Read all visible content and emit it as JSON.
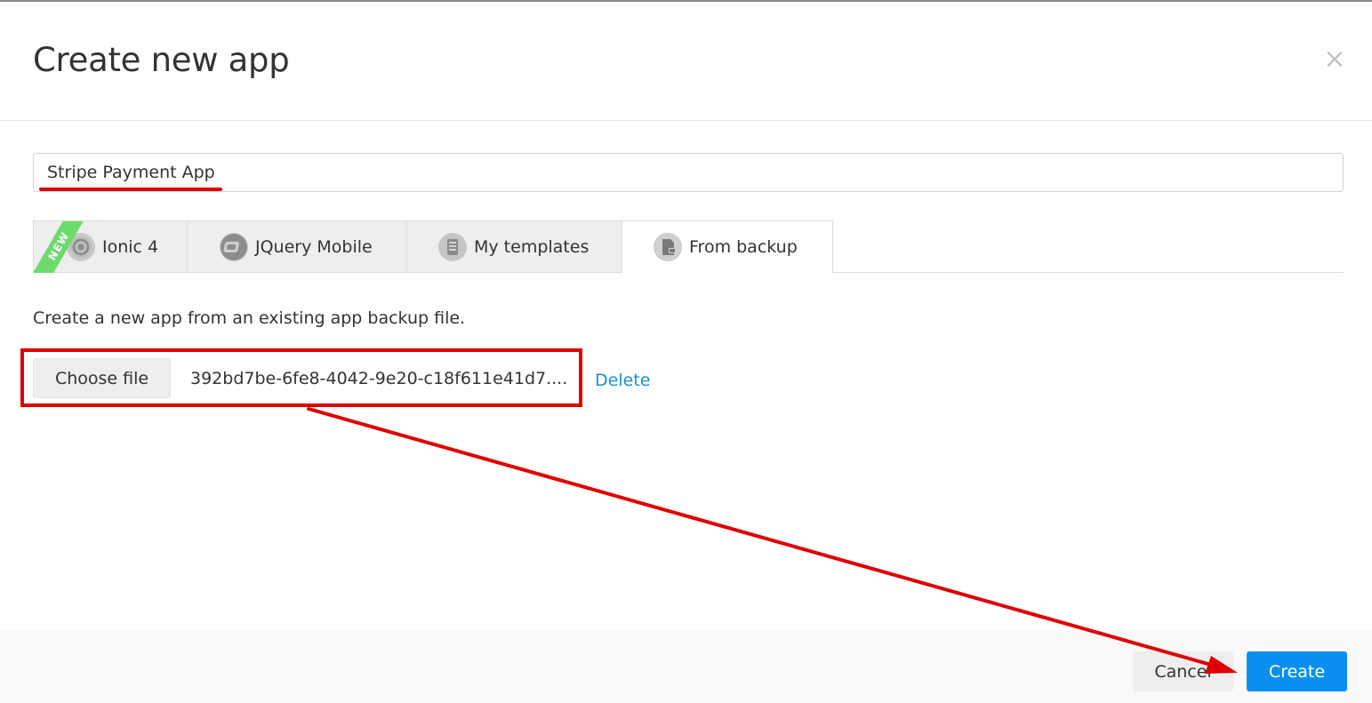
{
  "dialog": {
    "title": "Create new app",
    "close_symbol": "×"
  },
  "app_name_input": {
    "value": "Stripe Payment App"
  },
  "tabs": [
    {
      "label": "Ionic 4",
      "icon": "ionic-icon",
      "badge": "NEW",
      "active": false
    },
    {
      "label": "JQuery Mobile",
      "icon": "jquery-mobile-icon",
      "active": false
    },
    {
      "label": "My templates",
      "icon": "template-icon",
      "active": false
    },
    {
      "label": "From backup",
      "icon": "backup-file-icon",
      "active": true
    }
  ],
  "backup_panel": {
    "description": "Create a new app from an existing app backup file.",
    "choose_file_label": "Choose file",
    "file_name": "392bd7be-6fe8-4042-9e20-c18f611e41d7....",
    "delete_label": "Delete"
  },
  "footer": {
    "cancel_label": "Cancel",
    "create_label": "Create"
  },
  "colors": {
    "primary": "#0a8ff0",
    "link": "#1a8fd8",
    "annotation": "#e00000",
    "new_badge": "#6cdb6c"
  }
}
